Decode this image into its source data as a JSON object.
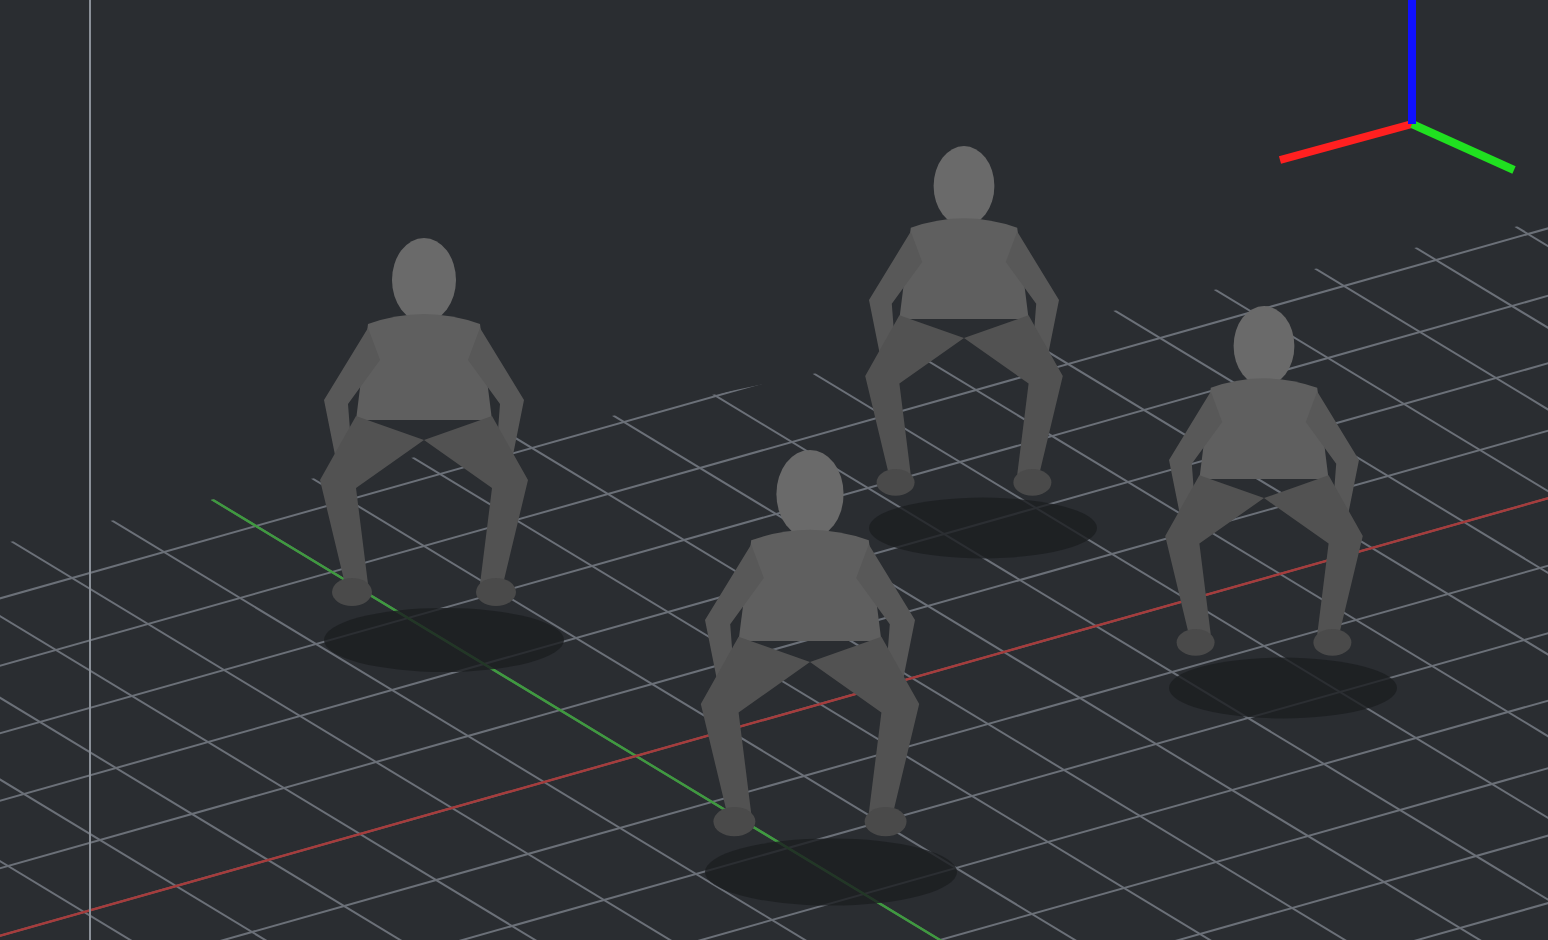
{
  "axis_gizmo": {
    "axes": [
      {
        "kind": "x",
        "color": "#ff2020"
      },
      {
        "kind": "y",
        "color": "#20e020"
      },
      {
        "kind": "z",
        "color": "#1010ff"
      }
    ]
  }
}
